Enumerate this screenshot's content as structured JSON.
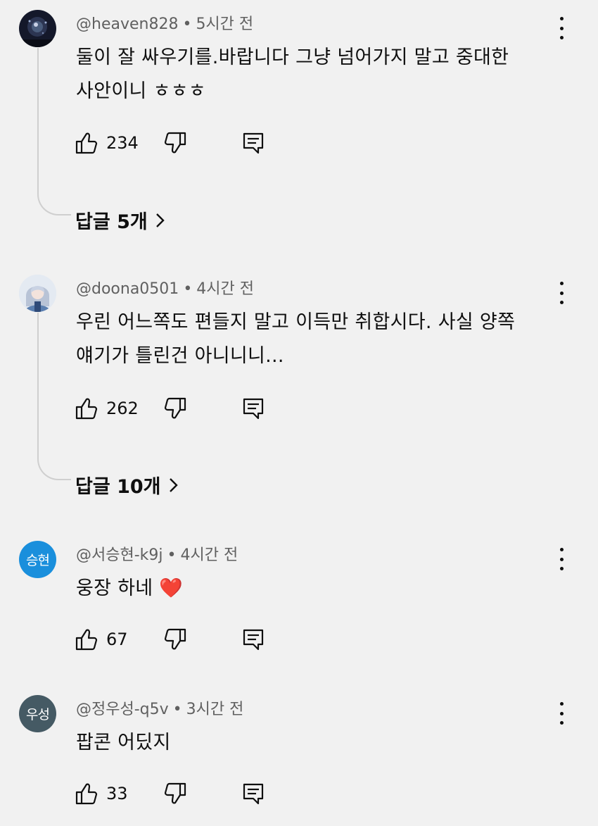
{
  "comments": [
    {
      "handle": "@heaven828",
      "time": "5시간 전",
      "text_lines": [
        "둘이 잘 싸우기를.바랍니다 그냥 넘어가지 말고 중대한",
        "사안이니 ㅎㅎㅎ"
      ],
      "likes": "234",
      "replies_label": "답글 5개",
      "avatar": {
        "type": "image",
        "icon": "dark-fireworks-avatar"
      }
    },
    {
      "handle": "@doona0501",
      "time": "4시간 전",
      "text_lines": [
        "우린 어느쪽도 편들지 말고 이득만 취합시다. 사실 양쪽",
        "얘기가 틀린건 아니니니..."
      ],
      "likes": "262",
      "replies_label": "답글 10개",
      "avatar": {
        "type": "image",
        "icon": "anime-character-avatar"
      }
    },
    {
      "handle": "@서승현-k9j",
      "time": "4시간 전",
      "text_lines": [
        "웅장 하네 ❤️"
      ],
      "likes": "67",
      "avatar": {
        "type": "initials",
        "initials": "승현",
        "color": "#1a8fdc"
      }
    },
    {
      "handle": "@정우성-q5v",
      "time": "3시간 전",
      "text_lines": [
        "팝콘 어딨지"
      ],
      "likes": "33",
      "avatar": {
        "type": "initials",
        "initials": "우성",
        "color": "#455a64"
      }
    }
  ],
  "icons": {
    "like": "thumbs-up-icon",
    "dislike": "thumbs-down-icon",
    "reply": "reply-comment-icon",
    "more": "more-vertical-icon",
    "chevron": "chevron-right-icon"
  },
  "colors": {
    "background": "#f1f1f1",
    "meta_text": "#606060",
    "thread_line": "#cfcfcf"
  }
}
